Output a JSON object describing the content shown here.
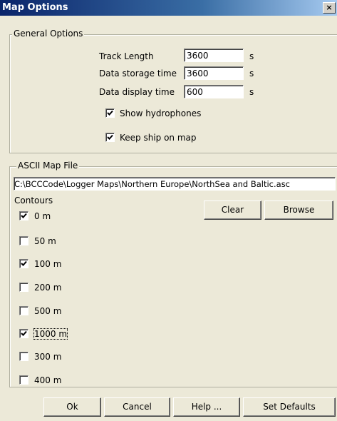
{
  "window": {
    "title": "Map Options",
    "close_glyph": "×"
  },
  "general": {
    "group_label": "General Options",
    "track_length": {
      "label": "Track Length",
      "value": "3600",
      "unit": "s"
    },
    "storage_time": {
      "label": "Data storage time",
      "value": "3600",
      "unit": "s"
    },
    "display_time": {
      "label": "Data display time",
      "value": "600",
      "unit": "s"
    },
    "show_hydrophones": {
      "label": "Show hydrophones",
      "checked": true
    },
    "keep_ship": {
      "label": "Keep ship on map",
      "checked": true
    }
  },
  "ascii_map": {
    "group_label": "ASCII Map File",
    "path": "C:\\BCCCode\\Logger Maps\\Northern Europe\\NorthSea and Baltic.asc",
    "contours_label": "Contours",
    "clear_label": "Clear",
    "browse_label": "Browse",
    "contours": [
      {
        "label": "0 m",
        "checked": true
      },
      {
        "label": "50 m",
        "checked": false
      },
      {
        "label": "100 m",
        "checked": true
      },
      {
        "label": "200 m",
        "checked": false
      },
      {
        "label": "500 m",
        "checked": false
      },
      {
        "label": "1000 m",
        "checked": true
      },
      {
        "label": "300 m",
        "checked": false
      },
      {
        "label": "400 m",
        "checked": false
      }
    ]
  },
  "footer": {
    "ok_label": "Ok",
    "cancel_label": "Cancel",
    "help_label": "Help ...",
    "defaults_label": "Set Defaults"
  },
  "colors": {
    "titlebar_start": "#0a246a",
    "titlebar_end": "#a6caf0",
    "dialog_bg": "#ece9d8"
  }
}
